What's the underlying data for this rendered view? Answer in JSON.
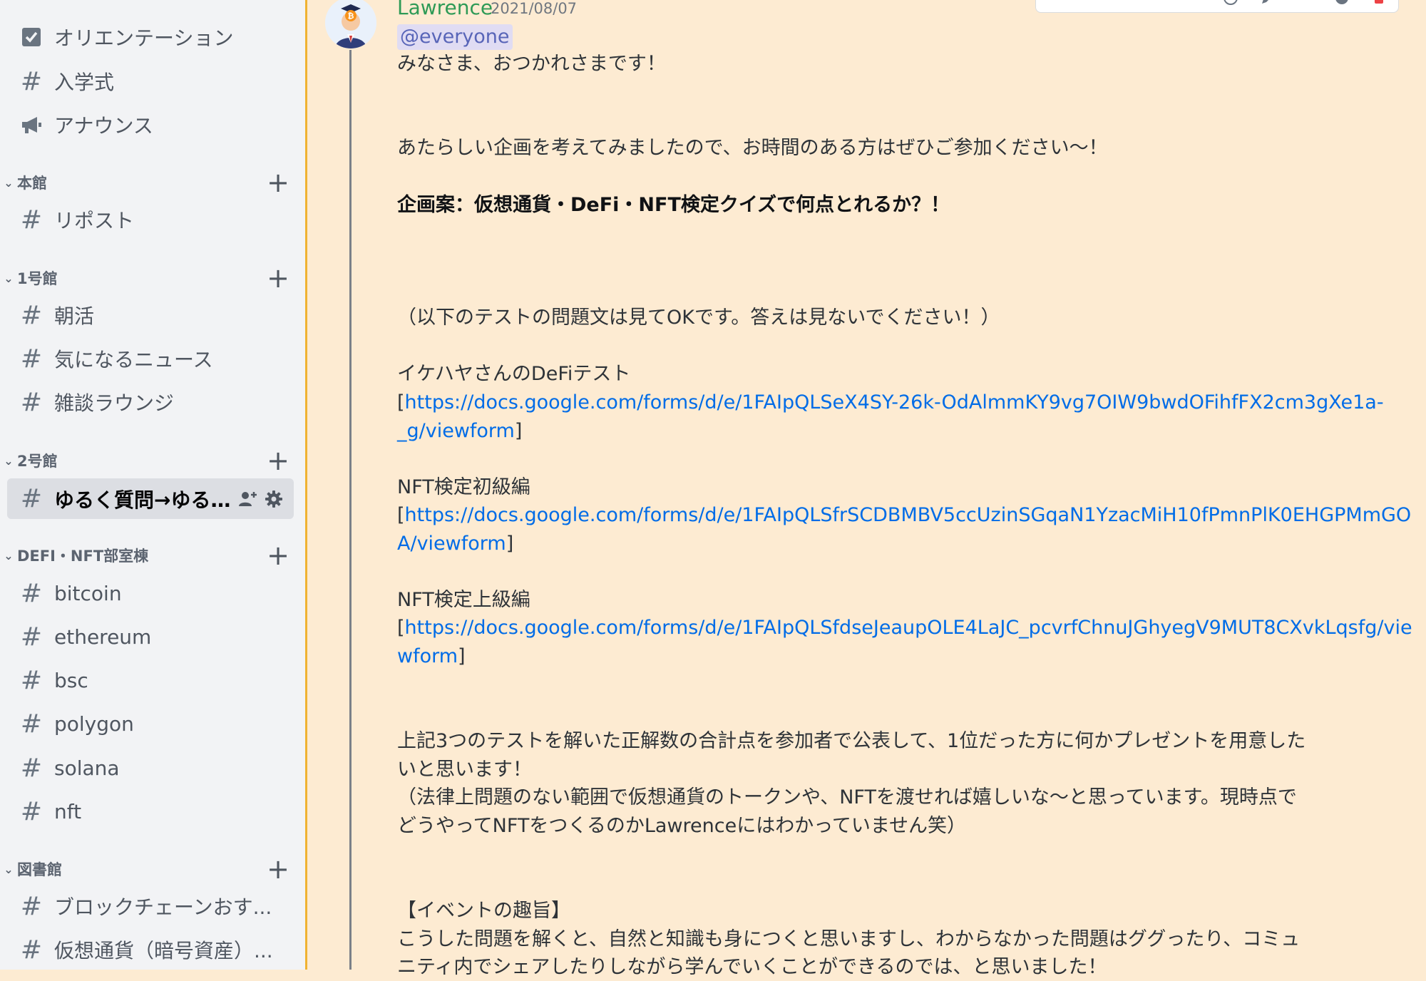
{
  "sidebar": {
    "channels_top": [
      {
        "name": "オリエンテーション",
        "icon": "checkbox-icon"
      },
      {
        "name": "入学式",
        "icon": "hash-icon"
      },
      {
        "name": "アナウンス",
        "icon": "megaphone-icon"
      }
    ],
    "categories": [
      {
        "name": "本館",
        "channels": [
          "リポスト"
        ]
      },
      {
        "name": "1号館",
        "channels": [
          "朝活",
          "気になるニュース",
          "雑談ラウンジ"
        ]
      },
      {
        "name": "2号館",
        "channels": [
          "ゆるく質問→ゆる..."
        ]
      },
      {
        "name": "DEFI・NFT部室棟",
        "channels": [
          "bitcoin",
          "ethereum",
          "bsc",
          "polygon",
          "solana",
          "nft"
        ]
      },
      {
        "name": "図書館",
        "channels": [
          "ブロックチェーンおす...",
          "仮想通貨（暗号資産）..."
        ]
      }
    ],
    "hash_glyph": "#",
    "plus_glyph": "+",
    "chevron_glyph": "⌄",
    "active_channel": "ゆるく質問→ゆる..."
  },
  "message": {
    "author": "Lawrence",
    "timestamp": "2021/08/07",
    "mention": "@everyone",
    "greeting": "みなさま、おつかれさまです！",
    "intro": "あたらしい企画を考えてみましたので、お時間のある方はぜひご参加ください〜！",
    "plan_title": "企画案：仮想通貨・DeFi・NFT検定クイズで何点とれるか？！",
    "note": "（以下のテストの問題文は見てOKです。答えは見ないでください！）",
    "tests": [
      {
        "label": "イケハヤさんのDeFiテスト",
        "url_line1": "https://docs.google.com/forms/d/e/1FAIpQLSeX4SY-26k-OdAlmmKY9vg7OIW9bwdOFihfFX2cm3gXe1a-",
        "url_line2": "_g/viewform"
      },
      {
        "label": "NFT検定初級編",
        "url_line1": "https://docs.google.com/forms/d/e/1FAIpQLSfrSCDBMBV5ccUzinSGqaN1YzacMiH10fPmnPlK0EHGPMmGO",
        "url_line2": "A/viewform"
      },
      {
        "label": "NFT検定上級編",
        "url_line1": "https://docs.google.com/forms/d/e/1FAIpQLSfdseJeaupOLE4LaJC_pcvrfChnuJGhyegV9MUT8CXvkLqsfg/vie",
        "url_line2": "wform"
      }
    ],
    "bracket_open": "[",
    "bracket_close": "]",
    "para1_line1": "上記3つのテストを解いた正解数の合計点を参加者で公表して、1位だった方に何かプレゼントを用意した",
    "para1_line2": "いと思います！",
    "para1_line3": "（法律上問題のない範囲で仮想通貨のトークンや、NFTを渡せれば嬉しいな〜と思っています。現時点で",
    "para1_line4": "どうやってNFTをつくるのかLawrenceにはわかっていません笑）",
    "section_heading": "【イベントの趣旨】",
    "para2_line1": "こうした問題を解くと、自然と知識も身につくと思いますし、わからなかった問題はググったり、コミュ",
    "para2_line2": "ニティ内でシェアしたりしながら学んでいくことができるのでは、と思いました！"
  },
  "colors": {
    "chat_bg": "#fdebd2",
    "author": "#2e9a56",
    "link": "#006ce7",
    "accent_bar": "#f0b232"
  }
}
